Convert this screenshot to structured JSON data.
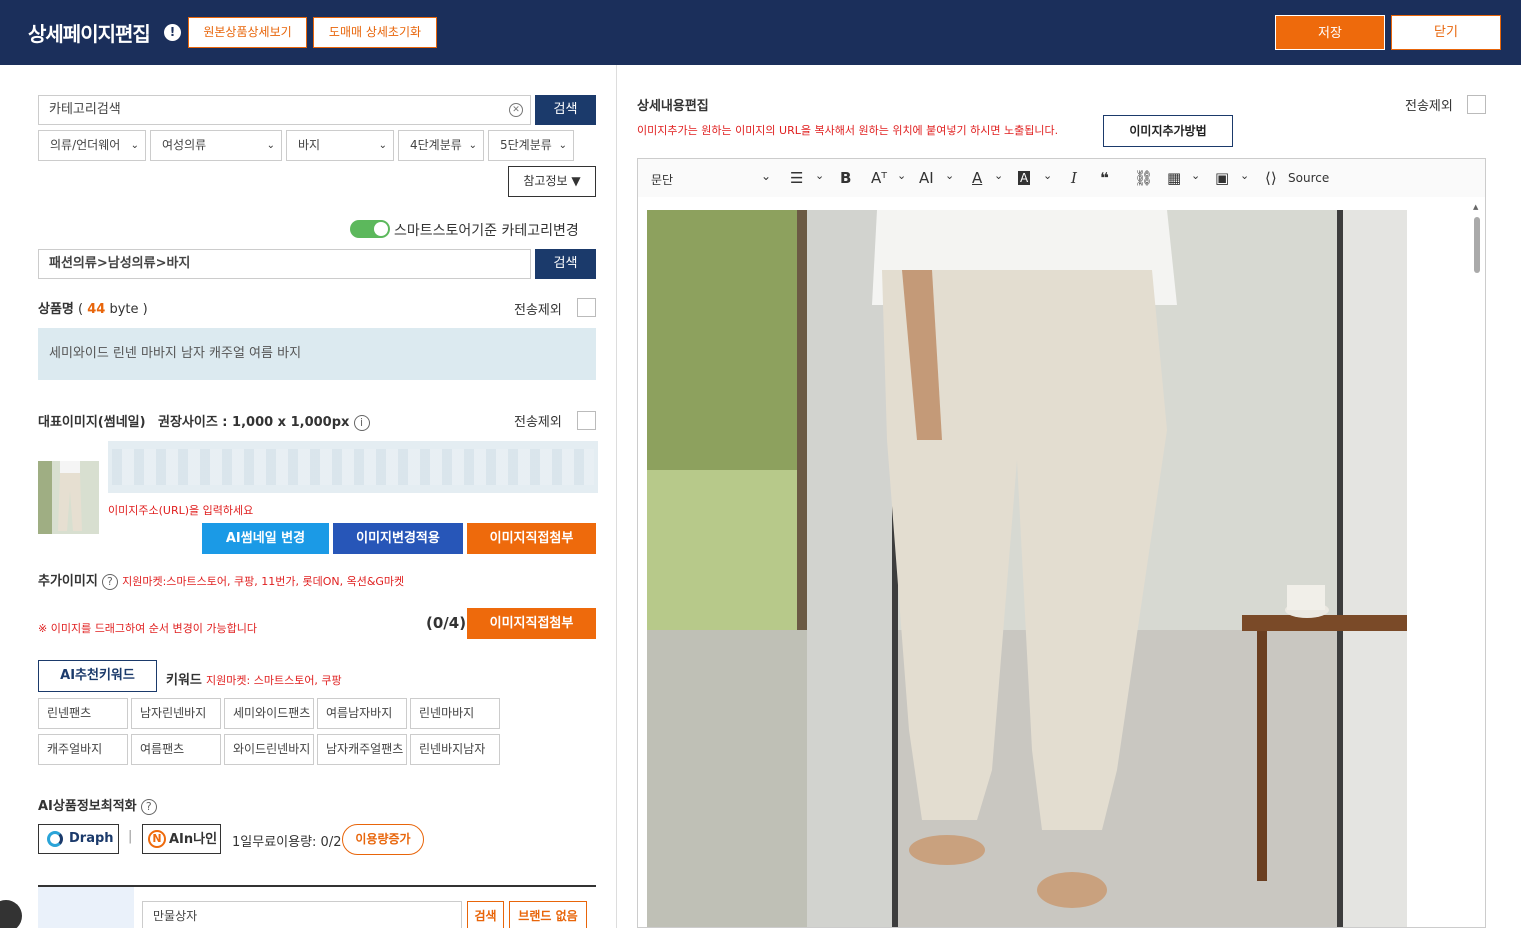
{
  "header": {
    "title": "상세페이지편집",
    "view_original_btn": "원본상품상세보기",
    "reset_btn": "도매매 상세초기화",
    "save_btn": "저장",
    "close_btn": "닫기"
  },
  "category": {
    "search_placeholder": "카테고리검색",
    "search_btn": "검색",
    "selects": [
      "의류/언더웨어",
      "여성의류",
      "바지",
      "4단계분류",
      "5단계분류"
    ],
    "ref_btn": "참고정보 ▼",
    "toggle_label": "스마트스토어기준 카테고리변경",
    "path_value": "패션의류>남성의류>바지",
    "path_search_btn": "검색"
  },
  "product_name": {
    "label": "상품명",
    "byte_prefix": "(",
    "byte_count": "44",
    "byte_suffix": "byte )",
    "exclude_label": "전송제외",
    "value": "세미와이드 린넨 마바지 남자 캐주얼 여름 바지"
  },
  "thumbnail": {
    "label": "대표이미지(썸네일)",
    "size_label": "권장사이즈 : 1,000 x 1,000px",
    "exclude_label": "전송제외",
    "url_hint": "이미지주소(URL)을 입력하세요",
    "ai_btn": "AI썸네일 변경",
    "apply_btn": "이미지변경적용",
    "attach_btn": "이미지직접첨부"
  },
  "extra_images": {
    "label": "추가이미지",
    "markets": "지원마켓:스마트스토어, 쿠팡, 11번가, 롯데ON, 옥션&G마켓",
    "drag_hint": "※ 이미지를 드래그하여 순서 변경이 가능합니다",
    "count": "(0/4)",
    "attach_btn": "이미지직접첨부"
  },
  "keywords": {
    "ai_btn": "AI추천키워드",
    "label": "키워드",
    "markets": "지원마켓: 스마트스토어, 쿠팡",
    "items": [
      "린넨팬츠",
      "남자린넨바지",
      "세미와이드팬츠",
      "여름남자바지",
      "린넨마바지",
      "캐주얼바지",
      "여름팬츠",
      "와이드린넨바지",
      "남자캐주얼팬츠",
      "린넨바지남자"
    ]
  },
  "ai_optimize": {
    "label": "AI상품정보최적화",
    "draph": "Draph",
    "nine_logo": "AIn나인",
    "usage": "1일무료이용량: 0/2",
    "increase_btn": "이용량증가"
  },
  "brand": {
    "value": "만물상자",
    "search_btn": "검색",
    "none_btn": "브랜드 없음"
  },
  "detail": {
    "title": "상세내용편집",
    "exclude_label": "전송제외",
    "hint": "이미지추가는 원하는 이미지의 URL을 복사해서 원하는 위치에 붙여넣기 하시면 노출됩니다.",
    "howto_btn": "이미지추가방법",
    "toolbar": {
      "paragraph": "문단",
      "source": "Source"
    }
  },
  "colors": {
    "navy": "#1b2f5b",
    "orange": "#ee6a0c",
    "blue": "#1b9ae6",
    "dark_blue": "#2756b8"
  }
}
